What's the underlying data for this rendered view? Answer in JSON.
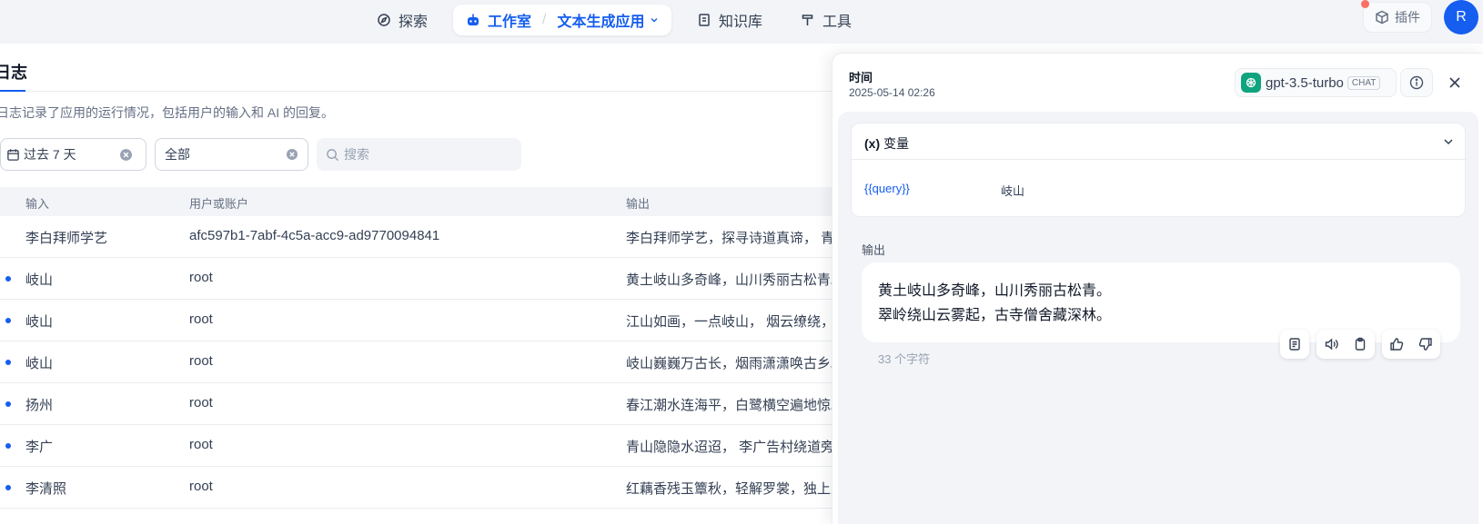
{
  "nav": {
    "explore": "探索",
    "studio": "工作室",
    "app_name": "文本生成应用",
    "knowledge": "知识库",
    "tools": "工具",
    "plugins": "插件",
    "avatar_initial": "R"
  },
  "log": {
    "title": "日志",
    "description": "日志记录了应用的运行情况，包括用户的输入和 AI 的回复。",
    "filter_period": "过去 7 天",
    "filter_status": "全部",
    "search_placeholder": "搜索",
    "columns": {
      "input": "输入",
      "user": "用户或账户",
      "output": "输出"
    },
    "rows": [
      {
        "input": "李白拜师学艺",
        "user": "afc597b1-7abf-4c5a-acc9-ad9770094841",
        "output": "李白拜师学艺，探寻诗道真谛， 青",
        "unread": false
      },
      {
        "input": "岐山",
        "user": "root",
        "output": "黄土岐山多奇峰，山川秀丽古松青。",
        "unread": true
      },
      {
        "input": "岐山",
        "user": "root",
        "output": "江山如画，一点岐山， 烟云缭绕，",
        "unread": true
      },
      {
        "input": "岐山",
        "user": "root",
        "output": "岐山巍巍万古长，烟雨潇潇唤古乡。",
        "unread": true
      },
      {
        "input": "扬州",
        "user": "root",
        "output": "春江潮水连海平，白鹭横空遍地惊。",
        "unread": true
      },
      {
        "input": "李广",
        "user": "root",
        "output": "青山隐隐水迢迢， 李广告村绕道旁",
        "unread": true
      },
      {
        "input": "李清照",
        "user": "root",
        "output": "红藕香残玉簟秋，轻解罗裳，独上兰",
        "unread": true
      }
    ]
  },
  "detail": {
    "time_label": "时间",
    "time_value": "2025-05-14 02:26",
    "model_name": "gpt-3.5-turbo",
    "model_mode": "CHAT",
    "variables_title": "变量",
    "variables_prefix": "(x)",
    "variable_key": "{{query}}",
    "variable_value": "岐山",
    "output_label": "输出",
    "output_line1": "黄土岐山多奇峰，山川秀丽古松青。",
    "output_line2": "翠岭绕山云雾起，古寺僧舍藏深林。",
    "char_count": "33 个字符"
  },
  "icons": {
    "explore": "compass-icon",
    "studio": "robot-icon",
    "knowledge": "book-icon",
    "tools": "hammer-icon",
    "plugins": "cube-icon",
    "model": "openai-icon"
  },
  "colors": {
    "accent": "#155eef",
    "model": "#10a37f",
    "badge": "#f97066"
  }
}
